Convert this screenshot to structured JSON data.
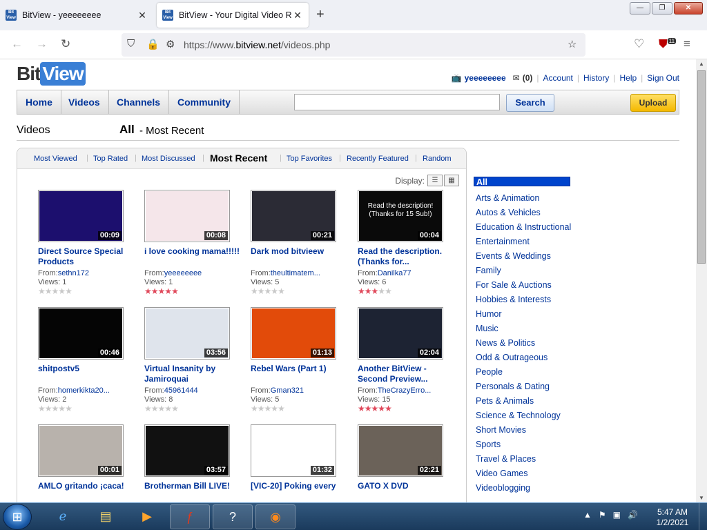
{
  "browser": {
    "tabs": [
      {
        "title": "BitView - yeeeeeeee",
        "active": false
      },
      {
        "title": "BitView - Your Digital Video Rep",
        "active": true
      }
    ],
    "url_prefix": "https://www.",
    "url_domain": "bitview.net",
    "url_path": "/videos.php",
    "notification_badge": "11"
  },
  "site": {
    "logo_left": "Bit",
    "logo_right": "View",
    "user": {
      "name": "yeeeeeeee",
      "mail_count": "(0)",
      "links": [
        "Account",
        "History",
        "Help",
        "Sign Out"
      ]
    },
    "nav": [
      "Home",
      "Videos",
      "Channels",
      "Community"
    ],
    "search_label": "Search",
    "search_value": "",
    "upload_label": "Upload"
  },
  "heading": {
    "section": "Videos",
    "filter": "All",
    "sort": "- Most Recent"
  },
  "subnav": {
    "items": [
      "Most Viewed",
      "Top Rated",
      "Most Discussed",
      "Most Recent",
      "Top Favorites",
      "Recently Featured",
      "Random"
    ],
    "current": "Most Recent"
  },
  "display_label": "Display:",
  "videos": [
    {
      "title": "Direct Source Special Products",
      "duration": "00:09",
      "from": "sethn172",
      "views": "1",
      "rating": 0,
      "thumb_color": "#1c0f6e"
    },
    {
      "title": "i love cooking mama!!!!!",
      "duration": "00:08",
      "from": "yeeeeeeee",
      "views": "1",
      "rating": 5,
      "thumb_color": "#f5e6ea"
    },
    {
      "title": "Dark mod bitvieew",
      "duration": "00:21",
      "from": "theultimatem...",
      "views": "5",
      "rating": 0,
      "thumb_color": "#2b2b35"
    },
    {
      "title": "Read the description. (Thanks for...",
      "duration": "00:04",
      "from": "Danilka77",
      "views": "6",
      "rating": 3,
      "thumb_color": "#0a0a0a",
      "thumb_text": "Read the description! (Thanks for 15 Sub!)"
    },
    {
      "title": "shitpostv5",
      "duration": "00:46",
      "from": "homerkikta20...",
      "views": "2",
      "rating": 0,
      "thumb_color": "#050505"
    },
    {
      "title": "Virtual Insanity by Jamiroquai",
      "duration": "03:56",
      "from": "45961444",
      "views": "8",
      "rating": 0,
      "thumb_color": "#dfe4ec"
    },
    {
      "title": "Rebel Wars (Part 1)",
      "duration": "01:13",
      "from": "Gman321",
      "views": "5",
      "rating": 0,
      "thumb_color": "#e24b0a"
    },
    {
      "title": "Another BitView - Second Preview...",
      "duration": "02:04",
      "from": "TheCrazyErro...",
      "views": "15",
      "rating": 5,
      "thumb_color": "#1d2333"
    },
    {
      "title": "AMLO gritando ¡caca!",
      "duration": "00:01",
      "from": "",
      "views": "",
      "rating": 0,
      "thumb_color": "#b8b2ac"
    },
    {
      "title": "Brotherman Bill LIVE!",
      "duration": "03:57",
      "from": "",
      "views": "",
      "rating": 0,
      "thumb_color": "#111"
    },
    {
      "title": "[VIC-20] Poking every",
      "duration": "01:32",
      "from": "",
      "views": "",
      "rating": 0,
      "thumb_color": "#ffffff"
    },
    {
      "title": "GATO X DVD",
      "duration": "02:21",
      "from": "",
      "views": "",
      "rating": 0,
      "thumb_color": "#6b6259"
    }
  ],
  "from_label": "From:",
  "views_label": "Views:",
  "categories": [
    "All",
    "Arts & Animation",
    "Autos & Vehicles",
    "Education & Instructional",
    "Entertainment",
    "Events & Weddings",
    "Family",
    "For Sale & Auctions",
    "Hobbies & Interests",
    "Humor",
    "Music",
    "News & Politics",
    "Odd & Outrageous",
    "People",
    "Personals & Dating",
    "Pets & Animals",
    "Science & Technology",
    "Short Movies",
    "Sports",
    "Travel & Places",
    "Video Games",
    "Videoblogging"
  ],
  "taskbar": {
    "time": "5:47 AM",
    "date": "1/2/2021"
  }
}
